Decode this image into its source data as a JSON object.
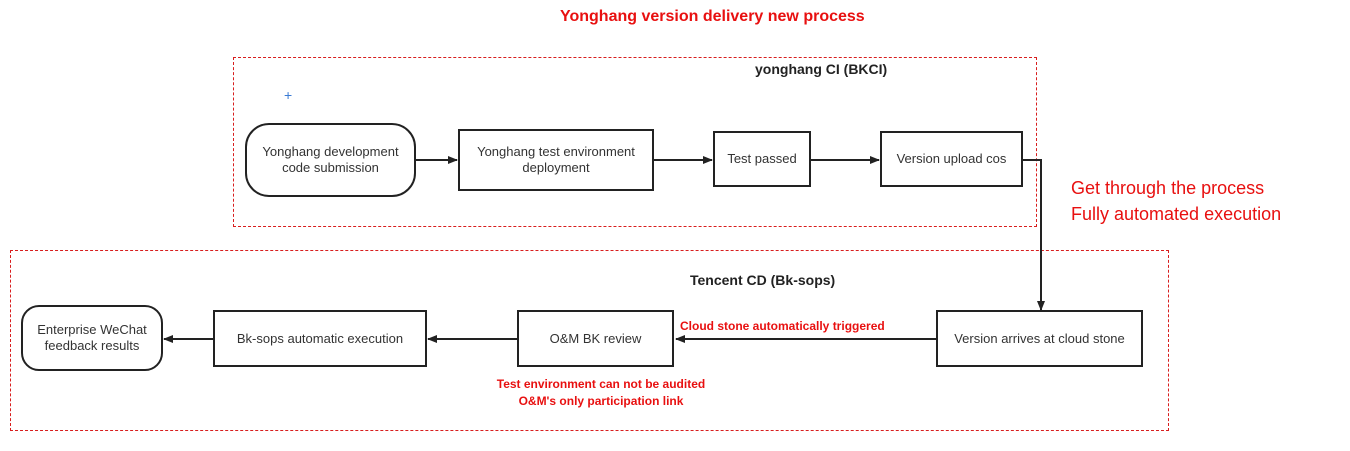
{
  "title": "Yonghang version delivery new process",
  "groups": {
    "ci": {
      "label": "yonghang CI  (BKCI)"
    },
    "cd": {
      "label": "Tencent CD  (Bk-sops)"
    }
  },
  "nodes": {
    "dev_submit": "Yonghang development code submission",
    "test_deploy": "Yonghang test environment deployment",
    "test_passed": "Test passed",
    "upload_cos": "Version upload cos",
    "arrives_cloud": "Version arrives at cloud stone",
    "om_review": "O&M BK review",
    "auto_exec": "Bk-sops automatic execution",
    "wechat_feedback": "Enterprise WeChat feedback results"
  },
  "edge_labels": {
    "cloud_trigger": "Cloud stone automatically triggered"
  },
  "notes": {
    "review_line1": "Test environment can not be audited",
    "review_line2": "O&M's only participation link",
    "side_line1": "Get through the process",
    "side_line2": "Fully automated execution"
  },
  "marker": "+",
  "colors": {
    "accent_red": "#e81010",
    "border": "#222222",
    "marker_blue": "#3a7bd5"
  }
}
